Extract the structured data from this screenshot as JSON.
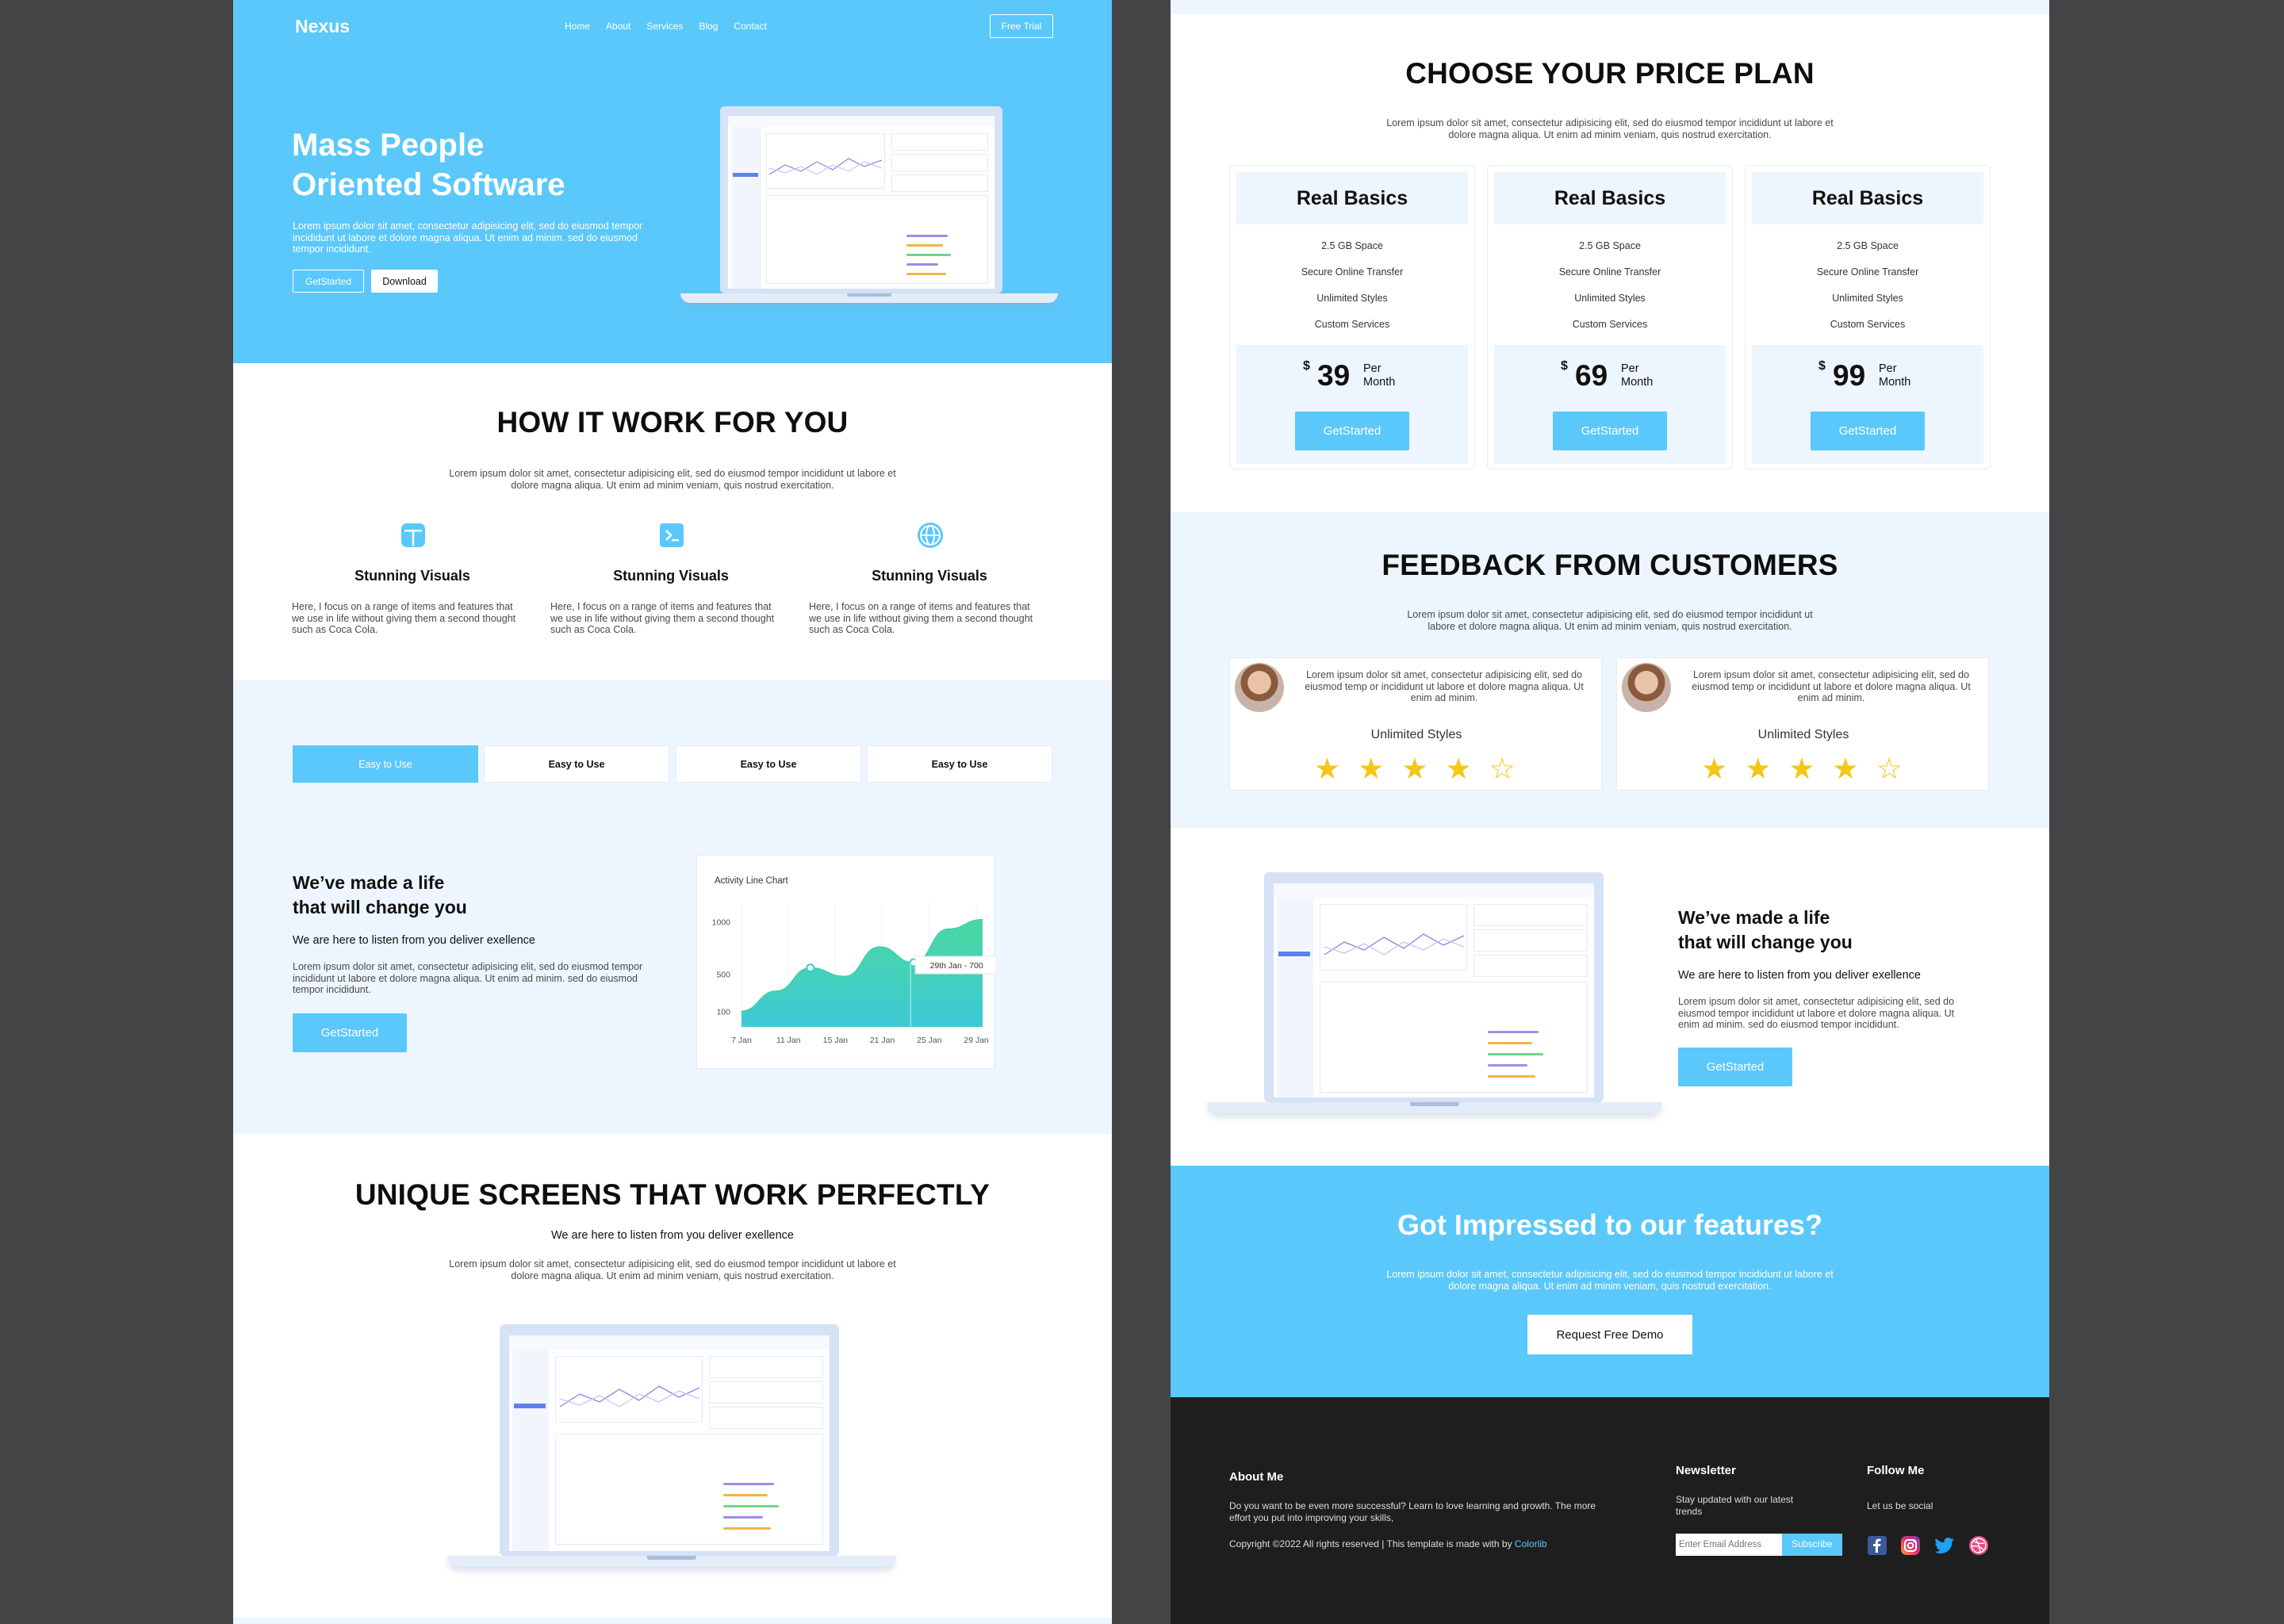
{
  "left": {
    "nav": {
      "logo": "Nexus",
      "links": [
        "Home",
        "About",
        "Services",
        "Blog",
        "Contact"
      ],
      "trial": "Free Trial"
    },
    "hero": {
      "title_line1": "Mass People",
      "title_line2": "Oriented Software",
      "text_line1": "Lorem ipsum dolor sit amet, consectetur adipisicing elit, sed do eiusmod tempor",
      "text_line2": "incididunt ut labore et dolore magna aliqua. Ut enim ad minim. sed do eiusmod",
      "text_line3": "tempor incididunt.",
      "btn_started": "GetStarted",
      "btn_download": "Download"
    },
    "how": {
      "title": "HOW IT WORK FOR YOU",
      "text_line1": "Lorem ipsum dolor sit amet, consectetur adipisicing elit, sed do eiusmod tempor incididunt ut labore et",
      "text_line2": "dolore magna aliqua. Ut enim ad minim veniam, quis nostrud exercitation.",
      "features": [
        {
          "icon": "layout-icon",
          "title": "Stunning Visuals",
          "line1": "Here, I focus on a range of items and features that",
          "line2": "we use in life without giving them a second thought",
          "line3": "such as Coca Cola."
        },
        {
          "icon": "terminal-icon",
          "title": "Stunning Visuals",
          "line1": "Here, I focus on a range of items and features that",
          "line2": "we use in life without giving them a second thought",
          "line3": "such as Coca Cola."
        },
        {
          "icon": "globe-icon",
          "title": "Stunning Visuals",
          "line1": "Here, I focus on a range of items and features that",
          "line2": "we use in life without giving them a second thought",
          "line3": "such as Coca Cola."
        }
      ]
    },
    "tabs": [
      "Easy to Use",
      "Easy to Use",
      "Easy to Use",
      "Easy to Use"
    ],
    "life": {
      "title_line1": "We’ve made a life",
      "title_line2": "that will change you",
      "subtitle": "We are here to listen from you deliver exellence",
      "text_line1": "Lorem ipsum dolor sit amet, consectetur adipisicing elit, sed do eiusmod tempor",
      "text_line2": "incididunt ut labore et dolore magna aliqua. Ut enim ad minim. sed do eiusmod",
      "text_line3": "tempor incididunt.",
      "button": "GetStarted"
    },
    "unique": {
      "title": "UNIQUE SCREENS THAT WORK PERFECTLY",
      "subtitle": "We are here to listen from you deliver exellence",
      "text_line1": "Lorem ipsum dolor sit amet, consectetur adipisicing elit, sed do eiusmod tempor incididunt ut labore et",
      "text_line2": "dolore magna aliqua. Ut enim ad minim veniam, quis nostrud exercitation."
    }
  },
  "chart_data": {
    "type": "area",
    "title": "Activity Line Chart",
    "x": [
      "7 Jan",
      "11 Jan",
      "15 Jan",
      "21 Jan",
      "25 Jan",
      "29 Jan"
    ],
    "y_ticks": [
      "1000",
      "500",
      "100"
    ],
    "series": [
      {
        "values": [
          150,
          340,
          560,
          480,
          760,
          610,
          930,
          1020
        ]
      }
    ],
    "tooltip": "29th Jan - 700",
    "colors": {
      "top": "#4ad8a0",
      "bottom": "#3ec9d6"
    }
  },
  "right": {
    "pricing": {
      "title": "CHOOSE YOUR PRICE PLAN",
      "text_line1": "Lorem ipsum dolor sit amet, consectetur adipisicing elit, sed do eiusmod tempor incididunt ut labore et",
      "text_line2": "dolore magna aliqua. Ut enim ad minim veniam, quis nostrud exercitation.",
      "plans": [
        {
          "name": "Real Basics",
          "features": [
            "2.5 GB Space",
            "Secure Online Transfer",
            "Unlimited Styles",
            "Custom Services"
          ],
          "currency": "$",
          "price": "39",
          "per": "Per",
          "period": "Month",
          "button": "GetStarted"
        },
        {
          "name": "Real Basics",
          "features": [
            "2.5 GB Space",
            "Secure Online Transfer",
            "Unlimited Styles",
            "Custom Services"
          ],
          "currency": "$",
          "price": "69",
          "per": "Per",
          "period": "Month",
          "button": "GetStarted"
        },
        {
          "name": "Real Basics",
          "features": [
            "2.5 GB Space",
            "Secure Online Transfer",
            "Unlimited Styles",
            "Custom Services"
          ],
          "currency": "$",
          "price": "99",
          "per": "Per",
          "period": "Month",
          "button": "GetStarted"
        }
      ]
    },
    "feedback": {
      "title": "FEEDBACK FROM CUSTOMERS",
      "text_line1": "Lorem ipsum dolor sit amet, consectetur adipisicing elit, sed do eiusmod tempor incididunt ut",
      "text_line2": "labore et dolore magna aliqua. Ut enim ad minim veniam, quis nostrud exercitation.",
      "cards": [
        {
          "line1": "Lorem ipsum dolor sit amet, consectetur adipisicing elit, sed do",
          "line2": "eiusmod temp or incididunt ut labore et dolore magna aliqua. Ut",
          "line3": "enim ad minim.",
          "name": "Unlimited Styles",
          "rating": 4,
          "stars": "★★★★☆"
        },
        {
          "line1": "Lorem ipsum dolor sit amet, consectetur adipisicing elit, sed do",
          "line2": "eiusmod temp or incididunt ut labore et dolore magna aliqua. Ut",
          "line3": "enim ad minim.",
          "name": "Unlimited Styles",
          "rating": 4,
          "stars": "★★★★☆"
        }
      ]
    },
    "life": {
      "title_line1": "We’ve made a life",
      "title_line2": "that will change you",
      "subtitle": "We are here to listen from you deliver exellence",
      "text_line1": "Lorem ipsum dolor sit amet, consectetur adipisicing elit, sed do",
      "text_line2": "eiusmod tempor incididunt ut labore et dolore magna aliqua. Ut",
      "text_line3": "enim ad minim. sed do eiusmod tempor incididunt.",
      "button": "GetStarted"
    },
    "cta": {
      "title": "Got Impressed to our features?",
      "text_line1": "Lorem ipsum dolor sit amet, consectetur adipisicing elit, sed do eiusmod tempor incididunt ut labore et",
      "text_line2": "dolore magna aliqua. Ut enim ad minim veniam, quis nostrud exercitation.",
      "button": "Request Free Demo"
    },
    "footer": {
      "about_title": "About Me",
      "about_line1": "Do you want to be even more successful? Learn to love learning and growth. The more",
      "about_line2": "effort you put into improving your skills,",
      "copyright": "Copyright ©2022 All rights reserved | This template is made with  by",
      "copyright_link": "Colorlib",
      "news_title": "Newsletter",
      "news_line1": "Stay updated with our latest",
      "news_line2": "trends",
      "email_placeholder": "Enter Email Address",
      "subscribe": "Subscribe",
      "follow_title": "Follow Me",
      "follow_text": "Let us be social",
      "socials": [
        "facebook-icon",
        "instagram-icon",
        "twitter-icon",
        "dribbble-icon"
      ]
    }
  }
}
